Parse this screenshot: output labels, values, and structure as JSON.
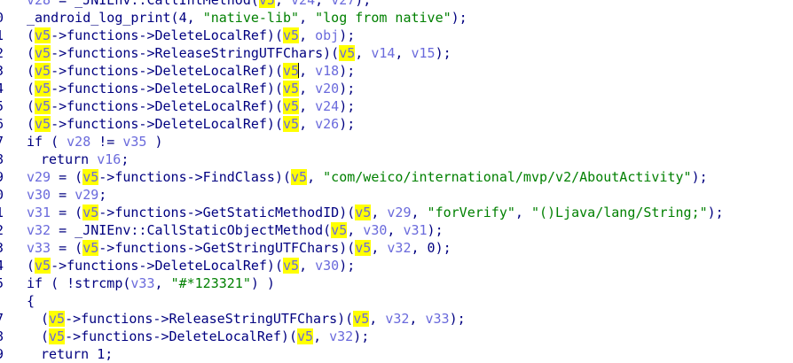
{
  "editor": {
    "lines": [
      {
        "num": "",
        "indent": 0,
        "tokens": [
          [
            "v",
            "v28"
          ],
          [
            "i",
            " = _JNIEnv::CallIntMethod("
          ],
          [
            "h",
            "v5"
          ],
          [
            "i",
            ", "
          ],
          [
            "v",
            "v24"
          ],
          [
            "i",
            ", "
          ],
          [
            "v",
            "v27"
          ],
          [
            "i",
            ");"
          ]
        ]
      },
      {
        "num": "0",
        "indent": 0,
        "tokens": [
          [
            "i",
            "_android_log_print(4, "
          ],
          [
            "s",
            "\"native-lib\""
          ],
          [
            "i",
            ", "
          ],
          [
            "s",
            "\"log from native\""
          ],
          [
            "i",
            ");"
          ]
        ]
      },
      {
        "num": "1",
        "indent": 0,
        "tokens": [
          [
            "i",
            "("
          ],
          [
            "h",
            "v5"
          ],
          [
            "i",
            "->functions->DeleteLocalRef)("
          ],
          [
            "h",
            "v5"
          ],
          [
            "i",
            ", "
          ],
          [
            "v",
            "obj"
          ],
          [
            "i",
            ");"
          ]
        ]
      },
      {
        "num": "2",
        "indent": 0,
        "tokens": [
          [
            "i",
            "("
          ],
          [
            "h",
            "v5"
          ],
          [
            "i",
            "->functions->ReleaseStringUTFChars)("
          ],
          [
            "h",
            "v5"
          ],
          [
            "i",
            ", "
          ],
          [
            "v",
            "v14"
          ],
          [
            "i",
            ", "
          ],
          [
            "v",
            "v15"
          ],
          [
            "i",
            ");"
          ]
        ]
      },
      {
        "num": "3",
        "indent": 0,
        "tokens": [
          [
            "i",
            "("
          ],
          [
            "h",
            "v5"
          ],
          [
            "i",
            "->functions->DeleteLocalRef)("
          ],
          [
            "h",
            "v5"
          ],
          [
            "caret",
            ""
          ],
          [
            "i",
            ", "
          ],
          [
            "v",
            "v18"
          ],
          [
            "i",
            ");"
          ]
        ]
      },
      {
        "num": "4",
        "indent": 0,
        "tokens": [
          [
            "i",
            "("
          ],
          [
            "h",
            "v5"
          ],
          [
            "i",
            "->functions->DeleteLocalRef)("
          ],
          [
            "h",
            "v5"
          ],
          [
            "i",
            ", "
          ],
          [
            "v",
            "v20"
          ],
          [
            "i",
            ");"
          ]
        ]
      },
      {
        "num": "5",
        "indent": 0,
        "tokens": [
          [
            "i",
            "("
          ],
          [
            "h",
            "v5"
          ],
          [
            "i",
            "->functions->DeleteLocalRef)("
          ],
          [
            "h",
            "v5"
          ],
          [
            "i",
            ", "
          ],
          [
            "v",
            "v24"
          ],
          [
            "i",
            ");"
          ]
        ]
      },
      {
        "num": "6",
        "indent": 0,
        "tokens": [
          [
            "i",
            "("
          ],
          [
            "h",
            "v5"
          ],
          [
            "i",
            "->functions->DeleteLocalRef)("
          ],
          [
            "h",
            "v5"
          ],
          [
            "i",
            ", "
          ],
          [
            "v",
            "v26"
          ],
          [
            "i",
            ");"
          ]
        ]
      },
      {
        "num": "7",
        "indent": 0,
        "tokens": [
          [
            "i",
            "if ( "
          ],
          [
            "v",
            "v28"
          ],
          [
            "i",
            " != "
          ],
          [
            "v",
            "v35"
          ],
          [
            "i",
            " )"
          ]
        ]
      },
      {
        "num": "8",
        "indent": 1,
        "tokens": [
          [
            "i",
            "return "
          ],
          [
            "v",
            "v16"
          ],
          [
            "i",
            ";"
          ]
        ]
      },
      {
        "num": "9",
        "indent": 0,
        "tokens": [
          [
            "v",
            "v29"
          ],
          [
            "i",
            " = ("
          ],
          [
            "h",
            "v5"
          ],
          [
            "i",
            "->functions->FindClass)("
          ],
          [
            "h",
            "v5"
          ],
          [
            "i",
            ", "
          ],
          [
            "s",
            "\"com/weico/international/mvp/v2/AboutActivity\""
          ],
          [
            "i",
            ");"
          ]
        ]
      },
      {
        "num": "0",
        "indent": 0,
        "tokens": [
          [
            "v",
            "v30"
          ],
          [
            "i",
            " = "
          ],
          [
            "v",
            "v29"
          ],
          [
            "i",
            ";"
          ]
        ]
      },
      {
        "num": "1",
        "indent": 0,
        "tokens": [
          [
            "v",
            "v31"
          ],
          [
            "i",
            " = ("
          ],
          [
            "h",
            "v5"
          ],
          [
            "i",
            "->functions->GetStaticMethodID)("
          ],
          [
            "h",
            "v5"
          ],
          [
            "i",
            ", "
          ],
          [
            "v",
            "v29"
          ],
          [
            "i",
            ", "
          ],
          [
            "s",
            "\"forVerify\""
          ],
          [
            "i",
            ", "
          ],
          [
            "s",
            "\"()Ljava/lang/String;\""
          ],
          [
            "i",
            ");"
          ]
        ]
      },
      {
        "num": "2",
        "indent": 0,
        "tokens": [
          [
            "v",
            "v32"
          ],
          [
            "i",
            " = _JNIEnv::CallStaticObjectMethod("
          ],
          [
            "h",
            "v5"
          ],
          [
            "i",
            ", "
          ],
          [
            "v",
            "v30"
          ],
          [
            "i",
            ", "
          ],
          [
            "v",
            "v31"
          ],
          [
            "i",
            ");"
          ]
        ]
      },
      {
        "num": "3",
        "indent": 0,
        "tokens": [
          [
            "v",
            "v33"
          ],
          [
            "i",
            " = ("
          ],
          [
            "h",
            "v5"
          ],
          [
            "i",
            "->functions->GetStringUTFChars)("
          ],
          [
            "h",
            "v5"
          ],
          [
            "i",
            ", "
          ],
          [
            "v",
            "v32"
          ],
          [
            "i",
            ", 0);"
          ]
        ]
      },
      {
        "num": "4",
        "indent": 0,
        "tokens": [
          [
            "i",
            "("
          ],
          [
            "h",
            "v5"
          ],
          [
            "i",
            "->functions->DeleteLocalRef)("
          ],
          [
            "h",
            "v5"
          ],
          [
            "i",
            ", "
          ],
          [
            "v",
            "v30"
          ],
          [
            "i",
            ");"
          ]
        ]
      },
      {
        "num": "5",
        "indent": 0,
        "tokens": [
          [
            "i",
            "if ( !strcmp("
          ],
          [
            "v",
            "v33"
          ],
          [
            "i",
            ", "
          ],
          [
            "s",
            "\"#*123321\""
          ],
          [
            "i",
            ") )"
          ]
        ]
      },
      {
        "num": "",
        "indent": 0,
        "tokens": [
          [
            "i",
            "{"
          ]
        ]
      },
      {
        "num": "7",
        "indent": 1,
        "tokens": [
          [
            "i",
            "("
          ],
          [
            "h",
            "v5"
          ],
          [
            "i",
            "->functions->ReleaseStringUTFChars)("
          ],
          [
            "h",
            "v5"
          ],
          [
            "i",
            ", "
          ],
          [
            "v",
            "v32"
          ],
          [
            "i",
            ", "
          ],
          [
            "v",
            "v33"
          ],
          [
            "i",
            ");"
          ]
        ]
      },
      {
        "num": "8",
        "indent": 1,
        "tokens": [
          [
            "i",
            "("
          ],
          [
            "h",
            "v5"
          ],
          [
            "i",
            "->functions->DeleteLocalRef)("
          ],
          [
            "h",
            "v5"
          ],
          [
            "i",
            ", "
          ],
          [
            "v",
            "v32"
          ],
          [
            "i",
            ");"
          ]
        ]
      },
      {
        "num": "9",
        "indent": 1,
        "tokens": [
          [
            "i",
            "return 1;"
          ]
        ]
      }
    ]
  }
}
